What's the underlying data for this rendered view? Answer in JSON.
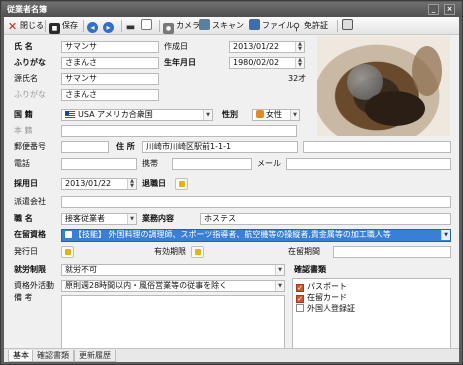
{
  "window": {
    "title": "従業者名簿"
  },
  "toolbar": {
    "close_label": "閉じる",
    "save_label": "保存",
    "camera_label": "カメラ",
    "scan_label": "スキャン",
    "file_label": "ファイル",
    "license_label": "免許証"
  },
  "form": {
    "name_label": "氏 名",
    "name_value": "サマンサ",
    "kana_label": "ふりがな",
    "kana_value": "さまんさ",
    "created_label": "作成日",
    "created_value": "2013/01/22",
    "birth_label": "生年月日",
    "birth_value": "1980/02/02",
    "age_value": "32才",
    "alias_label": "源氏名",
    "alias_value": "サマンサ",
    "alias_kana_label": "ふりがな",
    "alias_kana_value": "さまんさ",
    "nationality_label": "国 籍",
    "nationality_value": "USA アメリカ合衆国",
    "gender_label": "性別",
    "gender_value": "女性",
    "domicile_label": "本 籍",
    "postal_label": "郵便番号",
    "address_label": "住 所",
    "address_value": "川崎市川崎区駅前1-1-1",
    "phone_label": "電話",
    "mobile_label": "携帯",
    "mail_label": "メール",
    "hire_label": "採用日",
    "hire_value": "2013/01/22",
    "retire_label": "退職日",
    "dispatch_label": "派遣会社",
    "duty_label": "職 名",
    "duty_value": "接客従業者",
    "work_label": "業務内容",
    "work_value": "ホステス",
    "status_label": "在留資格",
    "status_value": "【技能】 外国料理の調理師、スポーツ指導者、航空機等の操縦者,貴金属等の加工職人等",
    "issue_label": "発行日",
    "valid_label": "有効期限",
    "stay_label": "在留期間",
    "employ_limit_label": "就労制限",
    "employ_limit_value": "就労不可",
    "extra_activity_label": "資格外活動",
    "extra_activity_value": "原則週28時間以内・風俗営業等の従事を除く",
    "remarks_label": "備 考",
    "docs_label": "確認書類",
    "docs": [
      {
        "label": "パスポート",
        "checked": true
      },
      {
        "label": "在留カード",
        "checked": true
      },
      {
        "label": "外国人登録証",
        "checked": false
      }
    ]
  },
  "tabs": [
    "基本",
    "確認書類",
    "更新履歴"
  ]
}
